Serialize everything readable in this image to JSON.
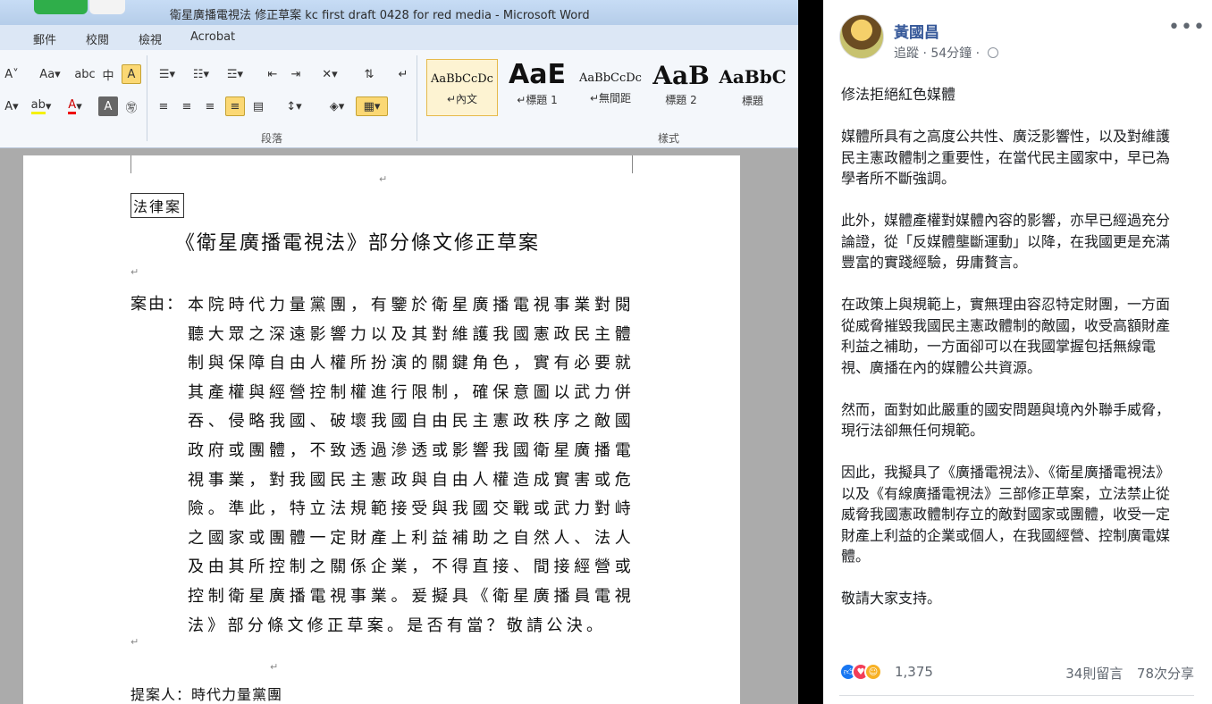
{
  "word": {
    "window_title": "衛星廣播電視法 修正草案  kc first draft 0428 for red media  -  Microsoft Word",
    "tabs": [
      "郵件",
      "校閱",
      "檢視",
      "Acrobat"
    ],
    "groups": {
      "paragraph": "段落",
      "styles": "樣式"
    },
    "styles": [
      {
        "sample": "AaBbCcDc",
        "name": "↵內文"
      },
      {
        "sample": "AaE",
        "name": "↵標題 1"
      },
      {
        "sample": "AaBbCcDc",
        "name": "↵無間距"
      },
      {
        "sample": "AaB",
        "name": "標題 2"
      },
      {
        "sample": "AaBbC",
        "name": "標題"
      }
    ],
    "document": {
      "law_tag": "法律案",
      "title": "《衛星廣播電視法》部分條文修正草案",
      "reason_label": "案由：",
      "reason_body": "本院時代力量黨團，有鑒於衛星廣播電視事業對閱聽大眾之深遠影響力以及其對維護我國憲政民主體制與保障自由人權所扮演的關鍵角色，實有必要就其產權與經營控制權進行限制，確保意圖以武力併吞、侵略我國、破壞我國自由民主憲政秩序之敵國政府或團體，不致透過滲透或影響我國衛星廣播電視事業，對我國民主憲政與自由人權造成實害或危險。準此，特立法規範接受與我國交戰或武力對峙之國家或團體一定財產上利益補助之自然人、法人及由其所控制之關係企業，不得直接、間接經營或控制衛星廣播電視事業。爰擬具《衛星廣播員電視法》部分條文修正草案。是否有當？敬請公決。",
      "proposer": "提案人：時代力量黨團"
    }
  },
  "facebook": {
    "author": "黃國昌",
    "follow_label": "追蹤",
    "time": "54分鐘",
    "paragraphs": [
      "修法拒絕紅色媒體",
      "媒體所具有之高度公共性、廣泛影響性，以及對維護民主憲政體制之重要性，在當代民主國家中，早已為學者所不斷強調。",
      "此外，媒體產權對媒體內容的影響，亦早已經過充分論證，從「反媒體壟斷運動」以降，在我國更是充滿豐富的實踐經驗，毋庸贅言。",
      "在政策上與規範上，實無理由容忍特定財團，一方面從威脅摧毀我國民主憲政體制的敵國，收受高額財產利益之補助，一方面卻可以在我國掌握包括無線電視、廣播在內的媒體公共資源。",
      "然而，面對如此嚴重的國安問題與境內外聯手威脅，現行法卻無任何規範。",
      "因此，我擬具了《廣播電視法》、《衛星廣播電視法》以及《有線廣播電視法》三部修正草案，立法禁止從威脅我國憲政體制存立的敵對國家或團體，收受一定財產上利益的企業或個人，在我國經營、控制廣電媒體。",
      "敬請大家支持。"
    ],
    "reaction_count": "1,375",
    "comments": "34則留言",
    "shares": "78次分享"
  }
}
